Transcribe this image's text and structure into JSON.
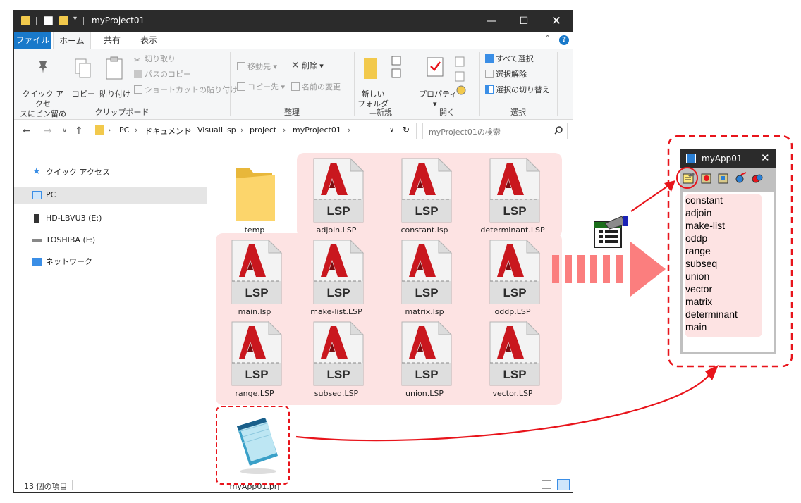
{
  "explorer": {
    "title": "myProject01",
    "menu_tabs": [
      "ファイル",
      "ホーム",
      "共有",
      "表示"
    ],
    "ribbon": {
      "pin_label_1": "クイック アクセ",
      "pin_label_2": "スにピン留め",
      "copy": "コピー",
      "paste": "貼り付け",
      "cut": "切り取り",
      "copy_path": "パスのコピー",
      "paste_shortcut": "ショートカットの貼り付け",
      "clipboard_group": "クリップボード",
      "move_to": "移動先",
      "copy_to": "コピー先",
      "delete": "削除",
      "rename": "名前の変更",
      "organize_group": "整理",
      "new_folder_1": "新しい",
      "new_folder_2": "フォルダー",
      "new_group": "新規",
      "properties": "プロパティ",
      "open_group": "開く",
      "select_all": "すべて選択",
      "select_none": "選択解除",
      "invert_selection": "選択の切り替え",
      "select_group": "選択"
    },
    "breadcrumb": [
      "PC",
      "ドキュメント",
      "VisualLisp",
      "project",
      "myProject01"
    ],
    "search_placeholder": "myProject01の検索",
    "nav_items": [
      {
        "label": "クイック アクセス",
        "icon": "star-icon"
      },
      {
        "label": "PC",
        "icon": "computer-icon"
      },
      {
        "label": "HD-LBVU3 (E:)",
        "icon": "drive-icon"
      },
      {
        "label": "TOSHIBA (F:)",
        "icon": "usb-drive-icon"
      },
      {
        "label": "ネットワーク",
        "icon": "network-icon"
      }
    ],
    "files": [
      {
        "name": "temp",
        "type": "folder"
      },
      {
        "name": "adjoin.LSP",
        "type": "lsp"
      },
      {
        "name": "constant.lsp",
        "type": "lsp"
      },
      {
        "name": "determinant.LSP",
        "type": "lsp"
      },
      {
        "name": "main.lsp",
        "type": "lsp"
      },
      {
        "name": "make-list.LSP",
        "type": "lsp"
      },
      {
        "name": "matrix.lsp",
        "type": "lsp"
      },
      {
        "name": "oddp.LSP",
        "type": "lsp"
      },
      {
        "name": "range.LSP",
        "type": "lsp"
      },
      {
        "name": "subseq.LSP",
        "type": "lsp"
      },
      {
        "name": "union.LSP",
        "type": "lsp"
      },
      {
        "name": "vector.LSP",
        "type": "lsp"
      },
      {
        "name": "myApp01.prj",
        "type": "notepad"
      }
    ],
    "lsp_badge": "LSP",
    "status": "13 個の項目"
  },
  "project_window": {
    "title": "myApp01",
    "items": [
      "constant",
      "adjoin",
      "make-list",
      "oddp",
      "range",
      "subseq",
      "union",
      "vector",
      "matrix",
      "determinant",
      "main"
    ]
  },
  "colors": {
    "accent_red": "#e8141b",
    "pink_highlight": "#fde3e3",
    "file_tab_blue": "#1979ca",
    "titlebar": "#2b2b2b"
  }
}
